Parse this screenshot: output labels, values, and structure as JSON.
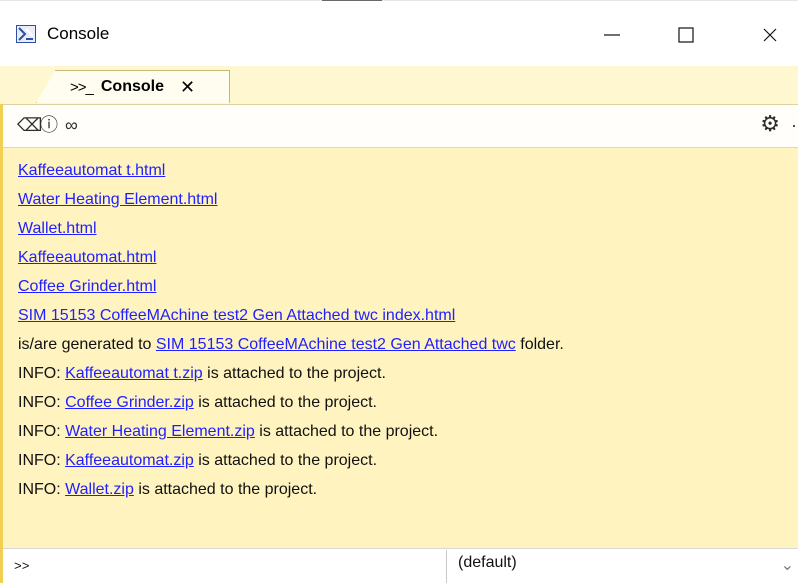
{
  "window": {
    "title": "Console",
    "controls": [
      "minimize-icon",
      "maximize-icon",
      "close-icon"
    ]
  },
  "tab": {
    "label": "Console",
    "icon": ">>_"
  },
  "toolbar": {
    "eraser_icon": "eraser-icon",
    "info_icon": "info-icon",
    "links_icon": "link-icon",
    "settings_icon": "gear-icon"
  },
  "output": {
    "links": [
      "Kaffeeautomat t.html",
      "Water Heating Element.html",
      "Wallet.html",
      "Kaffeeautomat.html",
      "Coffee Grinder.html",
      "SIM 15153 CoffeeMAchine test2 Gen Attached twc index.html"
    ],
    "generated_prefix": "is/are generated to ",
    "generated_link": "SIM 15153 CoffeeMAchine test2 Gen Attached twc",
    "generated_suffix": " folder.",
    "info_lines": [
      {
        "prefix": "INFO: ",
        "link": "Kaffeeautomat t.zip",
        "suffix": " is attached to the project."
      },
      {
        "prefix": "INFO: ",
        "link": "Coffee Grinder.zip",
        "suffix": " is attached to the project."
      },
      {
        "prefix": "INFO: ",
        "link": "Water Heating Element.zip",
        "suffix": " is attached to the project."
      },
      {
        "prefix": "INFO: ",
        "link": "Kaffeeautomat.zip",
        "suffix": " is attached to the project."
      },
      {
        "prefix": "INFO: ",
        "link": "Wallet.zip",
        "suffix": " is attached to the project."
      }
    ]
  },
  "command": {
    "value": ">>",
    "dropdown_value": "(default)",
    "dropdown_icon": "chevron-down-icon"
  },
  "colors": {
    "accent": "#f1cf53",
    "link": "#1f1fff",
    "tab_background": "#fff3bf"
  }
}
